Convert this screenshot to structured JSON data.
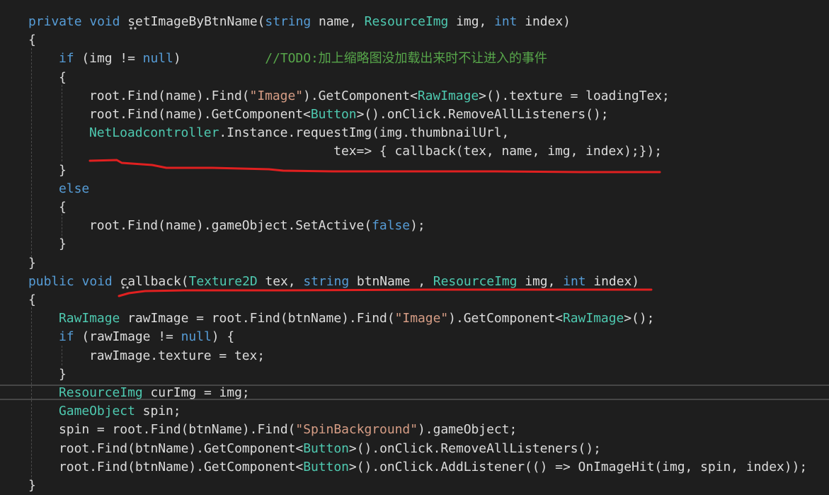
{
  "editor": {
    "lines": [
      {
        "indent": 0,
        "tokens": [
          [
            "kw",
            "private"
          ],
          [
            "pl",
            " "
          ],
          [
            "kw",
            "void"
          ],
          [
            "pl",
            " setImageByBtnName("
          ],
          [
            "kw",
            "string"
          ],
          [
            "pl",
            " name, "
          ],
          [
            "ty",
            "ResourceImg"
          ],
          [
            "pl",
            " img, "
          ],
          [
            "kw",
            "int"
          ],
          [
            "pl",
            " index)"
          ]
        ]
      },
      {
        "indent": 0,
        "tokens": [
          [
            "pl",
            "{"
          ]
        ]
      },
      {
        "indent": 1,
        "tokens": [
          [
            "kw",
            "if"
          ],
          [
            "pl",
            " (img != "
          ],
          [
            "kw",
            "null"
          ],
          [
            "pl",
            ")           "
          ],
          [
            "cm",
            "//TODO:加上缩略图没加载出来时不让进入的事件"
          ]
        ]
      },
      {
        "indent": 1,
        "tokens": [
          [
            "pl",
            "{"
          ]
        ]
      },
      {
        "indent": 2,
        "tokens": [
          [
            "pl",
            "root.Find(name).Find("
          ],
          [
            "st",
            "\"Image\""
          ],
          [
            "pl",
            ").GetComponent<"
          ],
          [
            "ty",
            "RawImage"
          ],
          [
            "pl",
            ">().texture = loadingTex;"
          ]
        ]
      },
      {
        "indent": 2,
        "tokens": [
          [
            "pl",
            "root.Find(name).GetComponent<"
          ],
          [
            "ty",
            "Button"
          ],
          [
            "pl",
            ">().onClick.RemoveAllListeners();"
          ]
        ]
      },
      {
        "indent": 2,
        "tokens": [
          [
            "ty",
            "NetLoadcontroller"
          ],
          [
            "pl",
            ".Instance.requestImg(img.thumbnailUrl,"
          ]
        ]
      },
      {
        "indent": 2,
        "tokens": [
          [
            "pl",
            "                                tex=> { callback(tex, name, img, index);});"
          ]
        ]
      },
      {
        "indent": 1,
        "tokens": [
          [
            "pl",
            "}"
          ]
        ]
      },
      {
        "indent": 1,
        "tokens": [
          [
            "kw",
            "else"
          ]
        ]
      },
      {
        "indent": 1,
        "tokens": [
          [
            "pl",
            "{"
          ]
        ]
      },
      {
        "indent": 2,
        "tokens": [
          [
            "pl",
            "root.Find(name).gameObject.SetActive("
          ],
          [
            "kw",
            "false"
          ],
          [
            "pl",
            ");"
          ]
        ]
      },
      {
        "indent": 1,
        "tokens": [
          [
            "pl",
            "}"
          ]
        ]
      },
      {
        "indent": 0,
        "tokens": [
          [
            "pl",
            "}"
          ]
        ]
      },
      {
        "indent": 0,
        "tokens": [
          [
            "kw",
            "public"
          ],
          [
            "pl",
            " "
          ],
          [
            "kw",
            "void"
          ],
          [
            "pl",
            " callback("
          ],
          [
            "ty",
            "Texture2D"
          ],
          [
            "pl",
            " tex, "
          ],
          [
            "kw",
            "string"
          ],
          [
            "pl",
            " btnName , "
          ],
          [
            "ty",
            "ResourceImg"
          ],
          [
            "pl",
            " img, "
          ],
          [
            "kw",
            "int"
          ],
          [
            "pl",
            " index)"
          ]
        ]
      },
      {
        "indent": 0,
        "tokens": [
          [
            "pl",
            "{"
          ]
        ]
      },
      {
        "indent": 1,
        "tokens": [
          [
            "ty",
            "RawImage"
          ],
          [
            "pl",
            " rawImage = root.Find(btnName).Find("
          ],
          [
            "st",
            "\"Image\""
          ],
          [
            "pl",
            ").GetComponent<"
          ],
          [
            "ty",
            "RawImage"
          ],
          [
            "pl",
            ">();"
          ]
        ]
      },
      {
        "indent": 1,
        "tokens": [
          [
            "kw",
            "if"
          ],
          [
            "pl",
            " (rawImage != "
          ],
          [
            "kw",
            "null"
          ],
          [
            "pl",
            ") {"
          ]
        ]
      },
      {
        "indent": 2,
        "tokens": [
          [
            "pl",
            "rawImage.texture = tex;"
          ]
        ]
      },
      {
        "indent": 1,
        "tokens": [
          [
            "pl",
            "}"
          ]
        ]
      },
      {
        "indent": 1,
        "tokens": [
          [
            "ty",
            "ResourceImg"
          ],
          [
            "pl",
            " curImg = img;"
          ]
        ]
      },
      {
        "indent": 1,
        "tokens": [
          [
            "ty",
            "GameObject"
          ],
          [
            "pl",
            " spin;"
          ]
        ]
      },
      {
        "indent": 1,
        "tokens": [
          [
            "pl",
            "spin = root.Find(btnName).Find("
          ],
          [
            "st",
            "\"SpinBackground\""
          ],
          [
            "pl",
            ").gameObject;"
          ]
        ]
      },
      {
        "indent": 1,
        "tokens": [
          [
            "pl",
            "root.Find(btnName).GetComponent<"
          ],
          [
            "ty",
            "Button"
          ],
          [
            "pl",
            ">().onClick.RemoveAllListeners();"
          ]
        ]
      },
      {
        "indent": 1,
        "tokens": [
          [
            "pl",
            "root.Find(btnName).GetComponent<"
          ],
          [
            "ty",
            "Button"
          ],
          [
            "pl",
            ">().onClick.AddListener(() => OnImageHit(img, spin, index));"
          ]
        ]
      },
      {
        "indent": 0,
        "tokens": [
          [
            "pl",
            "}"
          ]
        ]
      }
    ]
  },
  "colors": {
    "background": "#1e1e1e",
    "keyword": "#569cd6",
    "type": "#4ec9b0",
    "string": "#d69d85",
    "comment": "#57a64a",
    "plain": "#dcdcdc",
    "annotation": "#e02020"
  }
}
